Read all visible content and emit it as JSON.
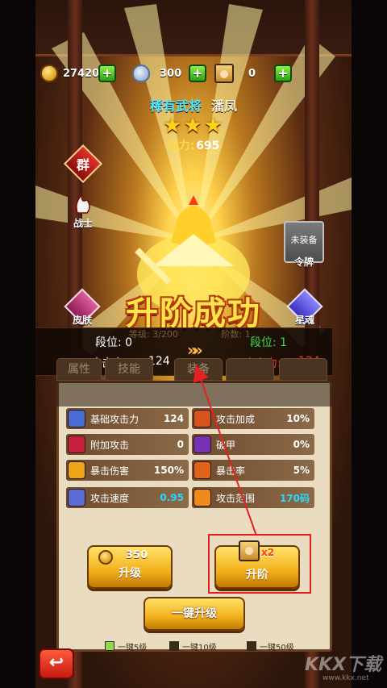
{
  "currency": {
    "gold": "27420",
    "silver": "300",
    "hero_tokens": "0",
    "plus": "+"
  },
  "hero": {
    "rarity": "稀有武将",
    "name": "潘凤",
    "stars": "★★★",
    "power_label": "战力:",
    "power_value": "695"
  },
  "side": {
    "faction": "群",
    "class": "战士",
    "token_status": "未装备",
    "token_label": "令牌",
    "skin_label": "皮肤",
    "soul_label": "星魂"
  },
  "result": {
    "title": "升阶成功",
    "rank_before": "段位: 0",
    "rank_after": "段位: 1",
    "atk_before_label": "攻击力:",
    "atk_before_value": "124",
    "atk_after_label": "攻击力:",
    "atk_after_value": "124",
    "arrow": "»",
    "behind_level": "等级: 3/200",
    "behind_stage": "阶数: 1"
  },
  "tabs": [
    "属性",
    "技能",
    "装备",
    "",
    ""
  ],
  "stats": [
    {
      "label": "基础攻击力",
      "value": "124",
      "color": "#4a6bd6"
    },
    {
      "label": "攻击加成",
      "value": "10%",
      "color": "#d8531a"
    },
    {
      "label": "附加攻击",
      "value": "0",
      "color": "#c7213f"
    },
    {
      "label": "破甲",
      "value": "0%",
      "color": "#7a2fb7"
    },
    {
      "label": "暴击伤害",
      "value": "150%",
      "color": "#f0a21a"
    },
    {
      "label": "暴击率",
      "value": "5%",
      "color": "#e0631a"
    },
    {
      "label": "攻击速度",
      "value": "0.95",
      "color": "#5a6bd6"
    },
    {
      "label": "攻击范围",
      "value": "170码",
      "color": "#f08a1a"
    }
  ],
  "buttons": {
    "upgrade_cost": "350",
    "upgrade_label": "升级",
    "advance_cost": "x2",
    "advance_label": "升阶",
    "one_key_label": "一键升级",
    "back": "↩"
  },
  "options": [
    {
      "label": "一键5级",
      "checked": true
    },
    {
      "label": "一键10级",
      "checked": false
    },
    {
      "label": "一键50级",
      "checked": false
    }
  ],
  "watermark": {
    "main": "KKX下载",
    "sub": "www.kkx.net"
  }
}
